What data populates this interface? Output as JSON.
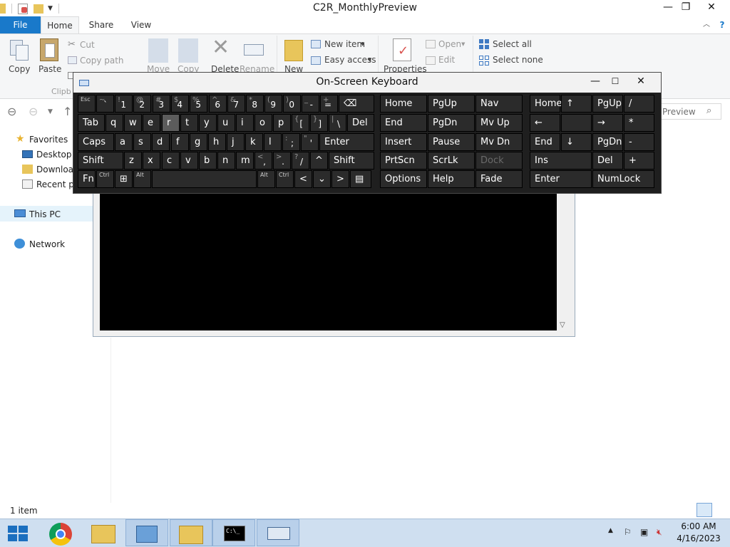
{
  "window": {
    "title": "C2R_MonthlyPreview",
    "minimize": "—",
    "restore": "❐",
    "close": "✕"
  },
  "ribbon": {
    "tabs": [
      "File",
      "Home",
      "Share",
      "View"
    ],
    "help": "?",
    "clipboard": {
      "copy": "Copy",
      "paste": "Paste",
      "cut": "Cut",
      "copy_path": "Copy path",
      "group": "Clipb"
    },
    "organize": {
      "move": "Move",
      "copy": "Copy",
      "delete": "Delete",
      "rename": "Rename"
    },
    "new": {
      "new": "New",
      "new_item": "New item",
      "easy_access": "Easy access"
    },
    "open": {
      "properties": "Properties",
      "open": "Open",
      "edit": "Edit"
    },
    "select": {
      "select_all": "Select all",
      "select_none": "Select none"
    }
  },
  "nav": {
    "search_placeholder": "Preview",
    "items": {
      "favorites": "Favorites",
      "desktop": "Desktop",
      "downloads": "Downloa",
      "recent": "Recent pl",
      "thispc": "This PC",
      "network": "Network"
    }
  },
  "status": {
    "count": "1 item"
  },
  "osk": {
    "title": "On-Screen Keyboard",
    "row1": [
      {
        "sub": "",
        "main": "Esc"
      },
      {
        "sub": "~",
        "main": "`"
      },
      {
        "sub": "!",
        "main": "1"
      },
      {
        "sub": "@",
        "main": "2"
      },
      {
        "sub": "#",
        "main": "3"
      },
      {
        "sub": "$",
        "main": "4"
      },
      {
        "sub": "%",
        "main": "5"
      },
      {
        "sub": "^",
        "main": "6"
      },
      {
        "sub": "&",
        "main": "7"
      },
      {
        "sub": "*",
        "main": "8"
      },
      {
        "sub": "(",
        "main": "9"
      },
      {
        "sub": ")",
        "main": "0"
      },
      {
        "sub": "_",
        "main": "-"
      },
      {
        "sub": "+",
        "main": "="
      },
      {
        "sub": "",
        "main": "⌫"
      }
    ],
    "row2": [
      "Tab",
      "q",
      "w",
      "e",
      "r",
      "t",
      "y",
      "u",
      "i",
      "o",
      "p",
      "[",
      "]",
      "\\",
      "Del"
    ],
    "row2_subs": [
      "",
      "",
      "",
      "",
      "",
      "",
      "",
      "",
      "",
      "",
      "",
      "{",
      "}",
      "|",
      ""
    ],
    "row3": [
      "Caps",
      "a",
      "s",
      "d",
      "f",
      "g",
      "h",
      "j",
      "k",
      "l",
      ";",
      "'",
      "Enter"
    ],
    "row3_subs": [
      "",
      "",
      "",
      "",
      "",
      "",
      "",
      "",
      "",
      "",
      ":",
      "\"",
      ""
    ],
    "row4": [
      "Shift",
      "z",
      "x",
      "c",
      "v",
      "b",
      "n",
      "m",
      ",",
      ".",
      "/",
      "^",
      "Shift"
    ],
    "row4_subs": [
      "",
      "",
      "",
      "",
      "",
      "",
      "",
      "",
      "<",
      ">",
      "?",
      "",
      ""
    ],
    "row5": [
      "Fn",
      "Ctrl",
      "⊞",
      "Alt",
      "",
      "Alt",
      "Ctrl",
      "<",
      "⌄",
      ">",
      "▤"
    ],
    "nav_keys": [
      [
        "Home",
        "PgUp",
        "Nav"
      ],
      [
        "End",
        "PgDn",
        "Mv Up"
      ],
      [
        "Insert",
        "Pause",
        "Mv Dn"
      ],
      [
        "PrtScn",
        "ScrLk",
        "Dock"
      ],
      [
        "Options",
        "Help",
        "Fade"
      ]
    ],
    "numpad": [
      [
        "Home",
        "↑",
        "PgUp",
        "/"
      ],
      [
        "←",
        "",
        "→",
        "*"
      ],
      [
        "End",
        "↓",
        "PgDn",
        "-"
      ],
      [
        "Ins",
        "",
        "Del",
        "+"
      ],
      [
        "Enter",
        "",
        "NumLock",
        ""
      ]
    ]
  },
  "taskbar": {
    "time": "6:00 AM",
    "date": "4/16/2023"
  }
}
